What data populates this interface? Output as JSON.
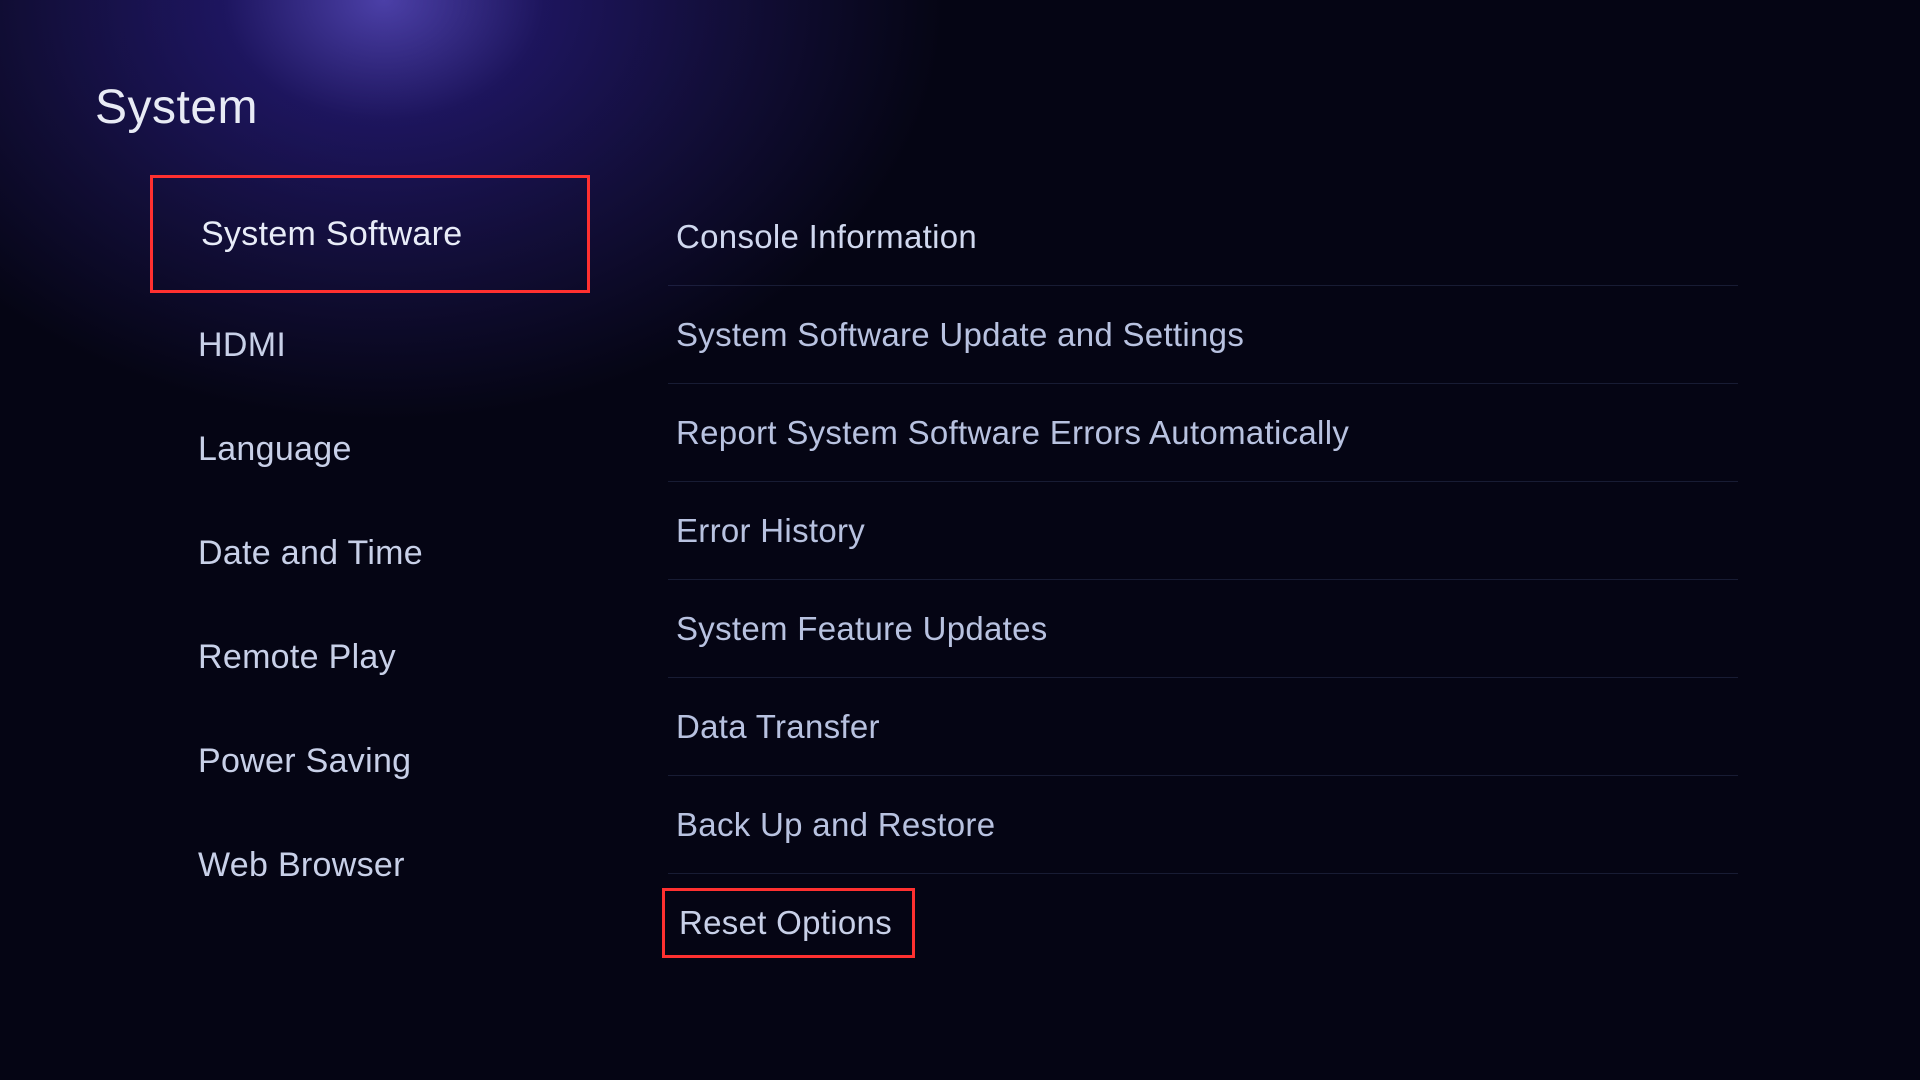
{
  "page_title": "System",
  "sidebar": {
    "items": [
      {
        "label": "System Software",
        "highlighted": true
      },
      {
        "label": "HDMI",
        "highlighted": false
      },
      {
        "label": "Language",
        "highlighted": false
      },
      {
        "label": "Date and Time",
        "highlighted": false
      },
      {
        "label": "Remote Play",
        "highlighted": false
      },
      {
        "label": "Power Saving",
        "highlighted": false
      },
      {
        "label": "Web Browser",
        "highlighted": false
      }
    ]
  },
  "content": {
    "items": [
      {
        "label": "Console Information",
        "highlighted": false
      },
      {
        "label": "System Software Update and Settings",
        "highlighted": false
      },
      {
        "label": "Report System Software Errors Automatically",
        "highlighted": false
      },
      {
        "label": "Error History",
        "highlighted": false
      },
      {
        "label": "System Feature Updates",
        "highlighted": false
      },
      {
        "label": "Data Transfer",
        "highlighted": false
      },
      {
        "label": "Back Up and Restore",
        "highlighted": false
      },
      {
        "label": "Reset Options",
        "highlighted": true
      }
    ]
  }
}
